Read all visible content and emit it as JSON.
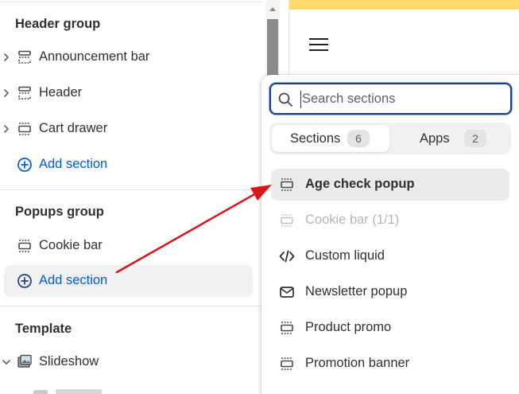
{
  "sidebar": {
    "header_group": {
      "title": "Header group",
      "items": [
        {
          "label": "Announcement bar",
          "icon": "section-icon"
        },
        {
          "label": "Header",
          "icon": "section-icon"
        },
        {
          "label": "Cart drawer",
          "icon": "section-icon"
        }
      ],
      "add_label": "Add section"
    },
    "popups_group": {
      "title": "Popups group",
      "items": [
        {
          "label": "Cookie bar",
          "icon": "section-icon"
        }
      ],
      "add_label": "Add section"
    },
    "template": {
      "title": "Template",
      "items": [
        {
          "label": "Slideshow",
          "icon": "slideshow-icon"
        }
      ]
    }
  },
  "popover": {
    "search": {
      "placeholder": "Search sections",
      "value": ""
    },
    "tabs": [
      {
        "label": "Sections",
        "count": "6",
        "active": true
      },
      {
        "label": "Apps",
        "count": "2",
        "active": false
      }
    ],
    "items": [
      {
        "label": "Age check popup",
        "icon": "section-icon",
        "state": "highlighted"
      },
      {
        "label": "Cookie bar (1/1)",
        "icon": "section-icon",
        "state": "disabled"
      },
      {
        "label": "Custom liquid",
        "icon": "code-icon",
        "state": "normal"
      },
      {
        "label": "Newsletter popup",
        "icon": "envelope-icon",
        "state": "normal"
      },
      {
        "label": "Product promo",
        "icon": "section-icon",
        "state": "normal"
      },
      {
        "label": "Promotion banner",
        "icon": "section-icon",
        "state": "normal"
      }
    ]
  },
  "colors": {
    "accent": "#005bd3",
    "annotation_arrow": "#d9141b",
    "preview_banner": "#ffd86b"
  }
}
